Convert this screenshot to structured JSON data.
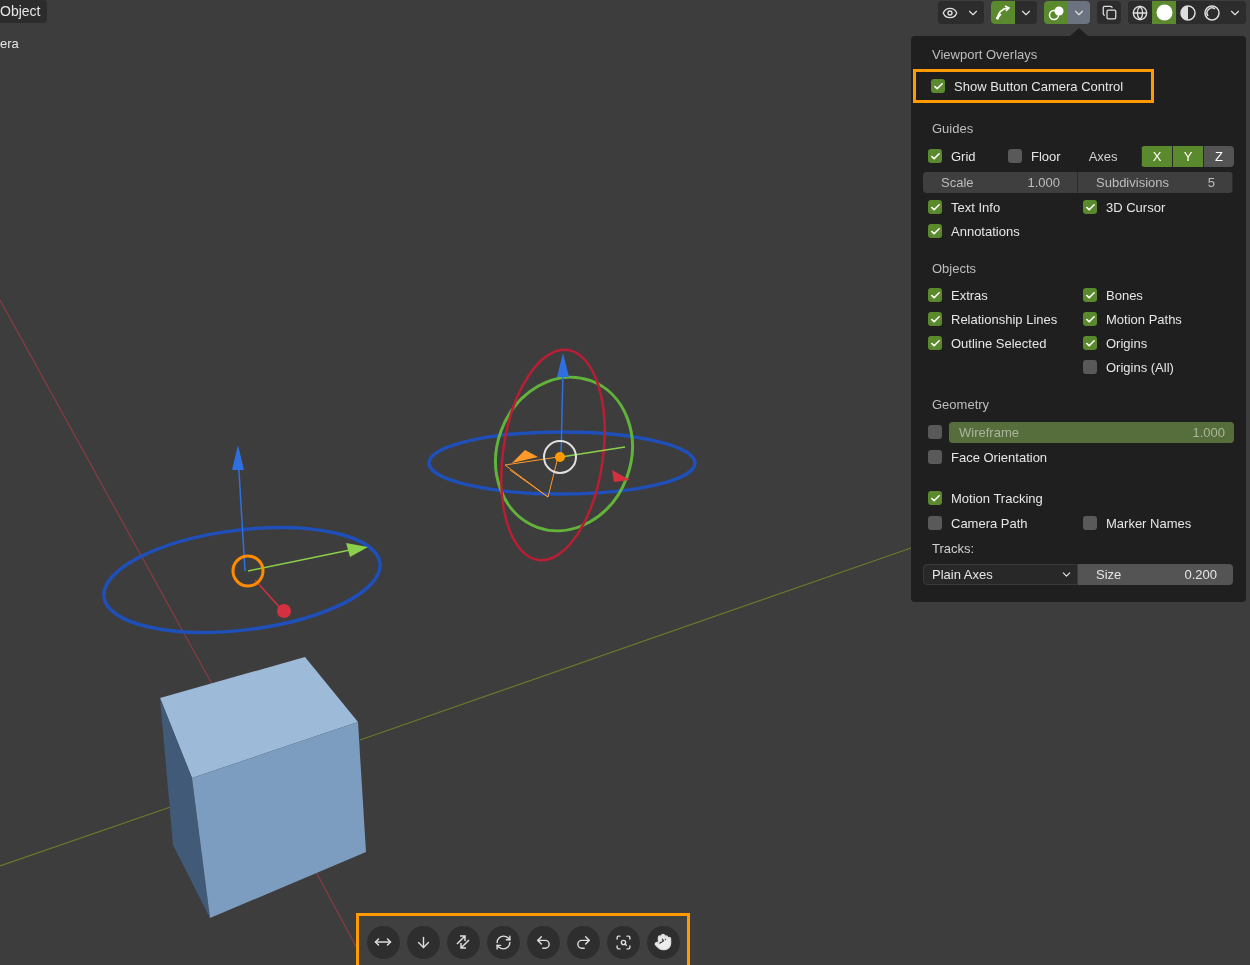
{
  "header": {
    "mode_button": "Object",
    "object_label": "era",
    "groups": [
      {
        "items": [
          {
            "kind": "visibility",
            "active": false
          },
          {
            "kind": "caret",
            "active": false
          }
        ]
      },
      {
        "items": [
          {
            "kind": "gizmo",
            "active": true
          },
          {
            "kind": "caret",
            "active": false
          }
        ]
      },
      {
        "items": [
          {
            "kind": "overlays",
            "active": true
          },
          {
            "kind": "caret",
            "active": true
          }
        ]
      },
      {
        "items": [
          {
            "kind": "xray",
            "active": false
          }
        ]
      },
      {
        "items": [
          {
            "kind": "wireframe",
            "active": false
          },
          {
            "kind": "solid",
            "active": true
          },
          {
            "kind": "material",
            "active": false
          },
          {
            "kind": "rendered",
            "active": false
          },
          {
            "kind": "caret",
            "active": false
          }
        ]
      }
    ]
  },
  "overlays": {
    "sections": [
      {
        "title": "Viewport Overlays",
        "highlighted": true,
        "rows": [
          {
            "kind": "check",
            "left": {
              "label": "Show Button Camera Control",
              "checked": true
            }
          }
        ]
      },
      {
        "title": "Guides",
        "rows": [
          {
            "kind": "guides",
            "grid": {
              "label": "Grid",
              "checked": true
            },
            "floor": {
              "label": "Floor",
              "checked": false
            },
            "axes_label": "Axes",
            "axes": [
              {
                "label": "X",
                "selected": true
              },
              {
                "label": "Y",
                "selected": true
              },
              {
                "label": "Z",
                "selected": false
              }
            ]
          },
          {
            "kind": "fields",
            "fields": [
              {
                "label": "Scale",
                "value": "1.000"
              },
              {
                "label": "Subdivisions",
                "value": "5"
              }
            ]
          },
          {
            "kind": "check",
            "left": {
              "label": "Text Info",
              "checked": true
            },
            "right": {
              "label": "3D Cursor",
              "checked": true
            }
          },
          {
            "kind": "check",
            "left": {
              "label": "Annotations",
              "checked": true
            }
          }
        ]
      },
      {
        "title": "Objects",
        "rows": [
          {
            "kind": "check",
            "left": {
              "label": "Extras",
              "checked": true
            },
            "right": {
              "label": "Bones",
              "checked": true
            }
          },
          {
            "kind": "check",
            "left": {
              "label": "Relationship Lines",
              "checked": true
            },
            "right": {
              "label": "Motion Paths",
              "checked": true
            }
          },
          {
            "kind": "check",
            "left": {
              "label": "Outline Selected",
              "checked": true
            },
            "right": {
              "label": "Origins",
              "checked": true
            }
          },
          {
            "kind": "check",
            "right": {
              "label": "Origins (All)",
              "checked": false
            }
          }
        ]
      },
      {
        "title": "Geometry",
        "rows": [
          {
            "kind": "slider",
            "checked": false,
            "label": "Wireframe",
            "value": "1.000",
            "level": 1
          },
          {
            "kind": "check",
            "left": {
              "label": "Face Orientation",
              "checked": false
            }
          }
        ]
      },
      {
        "rows": [
          {
            "kind": "panel_check",
            "left": {
              "label": "Motion Tracking",
              "checked": true
            }
          },
          {
            "kind": "check",
            "left": {
              "label": "Camera Path",
              "checked": false
            },
            "right": {
              "label": "Marker Names",
              "checked": false
            }
          },
          {
            "kind": "label",
            "text": "Tracks:"
          },
          {
            "kind": "tracks",
            "dropdown": "Plain Axes",
            "field": {
              "label": "Size",
              "value": "0.200"
            }
          }
        ]
      }
    ]
  },
  "toolbar": {
    "highlighted": true,
    "tools": [
      {
        "kind": "pan"
      },
      {
        "kind": "down"
      },
      {
        "kind": "diagonal"
      },
      {
        "kind": "orbit"
      },
      {
        "kind": "undo"
      },
      {
        "kind": "redo"
      },
      {
        "kind": "focus"
      },
      {
        "kind": "hand"
      }
    ]
  }
}
